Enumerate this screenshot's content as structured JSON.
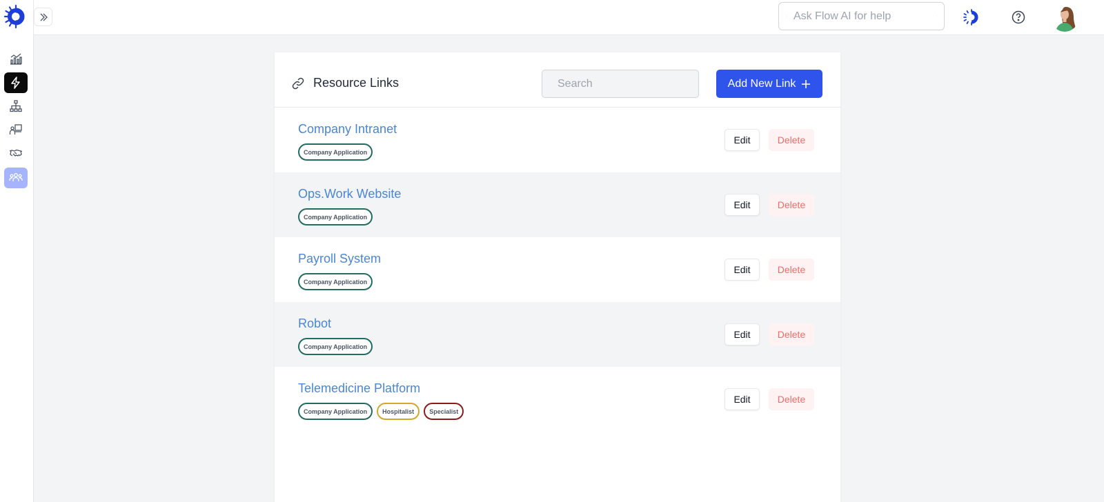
{
  "header": {
    "ai_search_placeholder": "Ask Flow AI for help"
  },
  "sidebar": {
    "items": [
      {
        "icon": "analytics-chart-icon",
        "active": false
      },
      {
        "icon": "lightning-icon",
        "active": true
      },
      {
        "icon": "org-chart-icon",
        "active": false
      },
      {
        "icon": "presentation-icon",
        "active": false
      },
      {
        "icon": "handshake-icon",
        "active": false
      },
      {
        "icon": "users-group-icon",
        "active": false
      }
    ]
  },
  "card": {
    "title": "Resource Links",
    "search_placeholder": "Search",
    "add_button_label": "Add New Link",
    "edit_label": "Edit",
    "delete_label": "Delete"
  },
  "links": [
    {
      "title": "Company Intranet",
      "tags": [
        {
          "label": "Company Application",
          "color": "#236b61"
        }
      ]
    },
    {
      "title": "Ops.Work Website",
      "tags": [
        {
          "label": "Company Application",
          "color": "#236b61"
        }
      ]
    },
    {
      "title": "Payroll System",
      "tags": [
        {
          "label": "Company Application",
          "color": "#236b61"
        }
      ]
    },
    {
      "title": "Robot",
      "tags": [
        {
          "label": "Company Application",
          "color": "#236b61"
        }
      ]
    },
    {
      "title": "Telemedicine Platform",
      "tags": [
        {
          "label": "Company Application",
          "color": "#236b61"
        },
        {
          "label": "Hospitalist",
          "color": "#d4a72c"
        },
        {
          "label": "Specialist",
          "color": "#8b1a1a"
        }
      ]
    }
  ],
  "colors": {
    "primary": "#2f54eb",
    "link_text": "#4a86d4",
    "delete_text": "#ef6b6b",
    "logo": "#1d3ed8"
  }
}
